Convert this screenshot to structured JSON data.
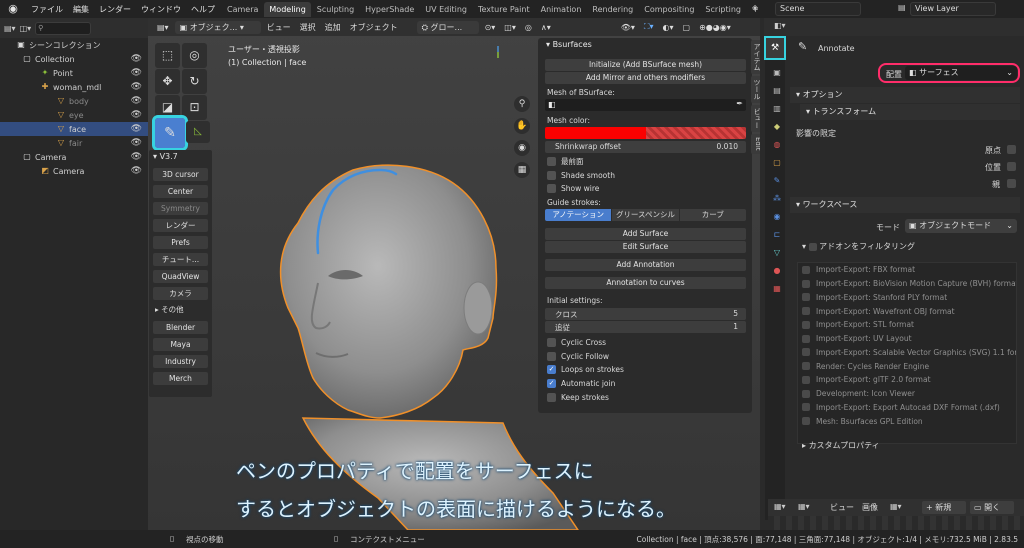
{
  "menu": [
    "ファイル",
    "編集",
    "レンダー",
    "ウィンドウ",
    "ヘルプ"
  ],
  "tabs": [
    "Camera",
    "Modeling",
    "Sculpting",
    "HyperShade",
    "UV Editing",
    "Texture Paint",
    "Animation",
    "Rendering",
    "Compositing",
    "Scripting"
  ],
  "active_tab": "Modeling",
  "tab_add": "+",
  "scene_name": "Scene",
  "view_layer": "View Layer",
  "outliner": {
    "title": "シーンコレクション",
    "rows": [
      {
        "label": "Collection",
        "icon": "collection-icon"
      },
      {
        "label": "Point",
        "icon": "light-icon"
      },
      {
        "label": "woman_mdl",
        "icon": "armature-icon"
      },
      {
        "label": "body",
        "icon": "mesh-icon"
      },
      {
        "label": "eye",
        "icon": "mesh-icon"
      },
      {
        "label": "face",
        "icon": "mesh-icon"
      },
      {
        "label": "fair",
        "icon": "mesh-icon"
      },
      {
        "label": "Camera",
        "icon": "collection-icon"
      },
      {
        "label": "Camera",
        "icon": "camera-icon"
      }
    ]
  },
  "viewport": {
    "header": {
      "mode": "オブジェク...",
      "view": "ビュー",
      "select": "選択",
      "add": "追加",
      "object": "オブジェクト",
      "transform": "グロー..."
    },
    "info_line1": "ユーザー・透視投影",
    "info_line2": "(1) Collection | face"
  },
  "v37_panel": {
    "title": "V3.7",
    "buttons": [
      "3D cursor",
      "Center",
      "Symmetry",
      "レンダー",
      "Prefs",
      "チュート...",
      "QuadView",
      "カメラ"
    ],
    "label": "その他",
    "buttons2": [
      "Blender",
      "Maya",
      "Industry",
      "Merch"
    ]
  },
  "bsurfaces": {
    "title": "Bsurfaces",
    "initialize": "Initialize (Add BSurface mesh)",
    "add_mirror": "Add Mirror and others modifiers",
    "mesh_label": "Mesh of BSurface:",
    "mesh_color_label": "Mesh color:",
    "mesh_color": "#ff0000",
    "shrinkwrap_label": "Shrinkwrap offset",
    "shrinkwrap_value": "0.010",
    "opt_front": "最前面",
    "opt_shade": "Shade smooth",
    "opt_wire": "Show wire",
    "guide_label": "Guide strokes:",
    "guide_opts": [
      "アノテーション",
      "グリースペンシル",
      "カーブ"
    ],
    "add_surface": "Add Surface",
    "edit_surface": "Edit Surface",
    "add_annotation": "Add Annotation",
    "anno_to_curves": "Annotation to curves",
    "initial_settings": "Initial settings:",
    "cross_label": "クロス",
    "cross_value": "5",
    "follow_label": "追従",
    "follow_value": "1",
    "cyclic_cross": "Cyclic Cross",
    "cyclic_follow": "Cyclic Follow",
    "loops_on_strokes": "Loops on strokes",
    "automatic_join": "Automatic join",
    "keep_strokes": "Keep strokes"
  },
  "sidetabs": [
    "アイテム",
    "ツール",
    "ビュー",
    "Edit"
  ],
  "properties": {
    "tool_name": "Annotate",
    "placement_label": "配置",
    "placement_value": "サーフェス",
    "options_title": "オプション",
    "transform_title": "トランスフォーム",
    "affect_label": "影響の限定",
    "affect_opts": [
      "原点",
      "位置",
      "親"
    ],
    "workspace_title": "ワークスペース",
    "mode_label": "モード",
    "mode_value": "オブジェクトモード",
    "filter_addons": "アドオンをフィルタリング",
    "addons": [
      "Import-Export: FBX format",
      "Import-Export: BioVision Motion Capture (BVH) format",
      "Import-Export: Stanford PLY format",
      "Import-Export: Wavefront OBJ format",
      "Import-Export: STL format",
      "Import-Export: UV Layout",
      "Import-Export: Scalable Vector Graphics (SVG) 1.1 format",
      "Render: Cycles Render Engine",
      "Import-Export: glTF 2.0 format",
      "Development: Icon Viewer",
      "Import-Export: Export Autocad DXF Format (.dxf)",
      "Mesh: Bsurfaces GPL Edition"
    ],
    "custom_props": "カスタムプロパティ"
  },
  "timeline_header": {
    "view": "ビュー",
    "image": "画像",
    "new": "新規",
    "open": "開く"
  },
  "status": {
    "left": "視点の移動",
    "middle": "コンテクストメニュー",
    "right": "Collection | face | 頂点:38,576 | 面:77,148 | 三角面:77,148 | オブジェクト:1/4 | メモリ:732.5 MiB | 2.83.5"
  },
  "caption": {
    "line1": "ペンのプロパティで配置をサーフェスに",
    "line2": "するとオブジェクトの表面に描けるようになる。"
  }
}
